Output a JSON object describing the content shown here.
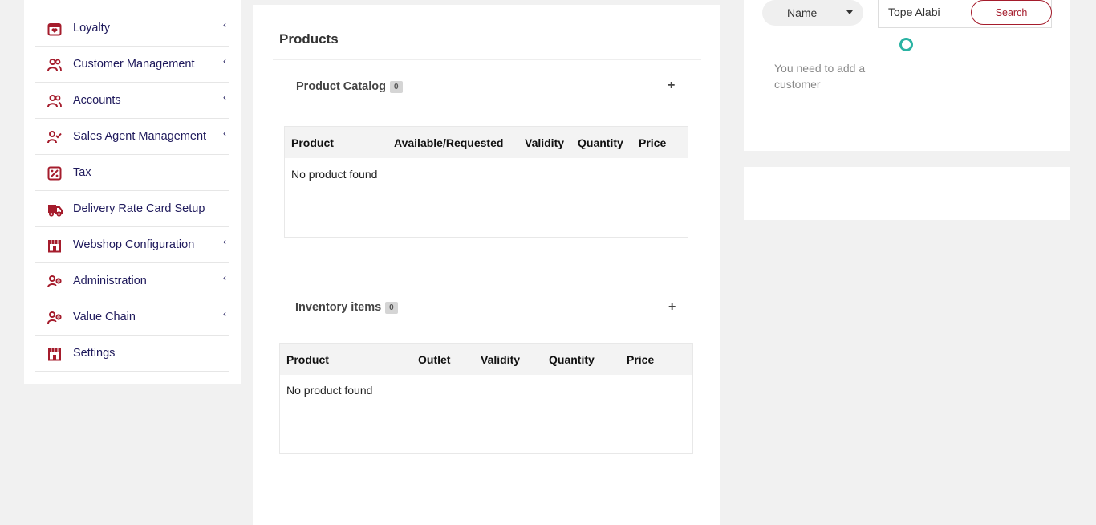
{
  "sidebar": {
    "items": [
      {
        "label": "Loyalty",
        "icon": "gift-icon",
        "chevron": true
      },
      {
        "label": "Customer Management",
        "icon": "users-icon",
        "chevron": true
      },
      {
        "label": "Accounts",
        "icon": "users-icon",
        "chevron": true
      },
      {
        "label": "Sales Agent Management",
        "icon": "user-check-icon",
        "chevron": true
      },
      {
        "label": "Tax",
        "icon": "percent-icon",
        "chevron": false
      },
      {
        "label": "Delivery Rate Card Setup",
        "icon": "truck-icon",
        "chevron": false
      },
      {
        "label": "Webshop Configuration",
        "icon": "store-icon",
        "chevron": true
      },
      {
        "label": "Administration",
        "icon": "user-gear-icon",
        "chevron": true
      },
      {
        "label": "Value Chain",
        "icon": "user-gear-icon",
        "chevron": true
      },
      {
        "label": "Settings",
        "icon": "store-icon",
        "chevron": false
      }
    ],
    "chevron_glyph": "‹"
  },
  "products": {
    "title": "Products",
    "catalog": {
      "heading": "Product Catalog",
      "count": "0",
      "add_glyph": "+",
      "columns": [
        "Product",
        "Available/Requested",
        "Validity",
        "Quantity",
        "Price"
      ],
      "empty_text": "No product found"
    },
    "inventory": {
      "heading": "Inventory items",
      "count": "0",
      "add_glyph": "+",
      "columns": [
        "Product",
        "Outlet",
        "Validity",
        "Quantity",
        "Price"
      ],
      "empty_text": "No product found"
    }
  },
  "customer_search": {
    "field_select": "Name",
    "query": "Tope Alabi",
    "search_label": "Search",
    "hint": "You need to add a customer"
  },
  "colors": {
    "accent": "#a51c2c",
    "nav_text": "#1f1a5c",
    "spinner": "#2ab3a3"
  }
}
